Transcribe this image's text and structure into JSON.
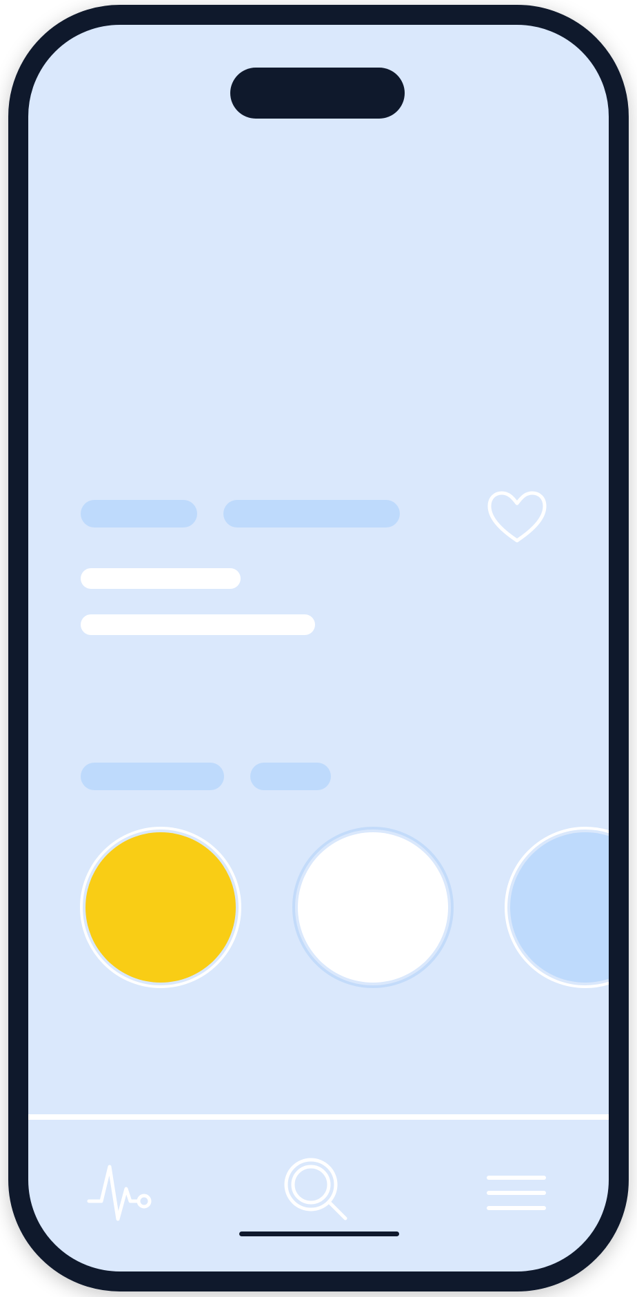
{
  "screen": {
    "background_color": "#dae8fc",
    "frame_color": "#0f192c"
  },
  "content": {
    "header_placeholders": [
      "blue-pill",
      "blue-pill"
    ],
    "text_placeholders": [
      "white-line",
      "white-line"
    ],
    "category_placeholders": [
      "blue-pill",
      "blue-pill"
    ],
    "favorite_icon": "heart-icon",
    "color_options": [
      {
        "name": "yellow",
        "color": "#f9cd15",
        "selected": false
      },
      {
        "name": "white",
        "color": "#ffffff",
        "selected": true
      },
      {
        "name": "light-blue",
        "color": "#bedafc",
        "selected": false
      }
    ]
  },
  "bottom_nav": {
    "items": [
      {
        "icon": "activity-icon"
      },
      {
        "icon": "search-icon"
      },
      {
        "icon": "menu-icon"
      }
    ]
  }
}
